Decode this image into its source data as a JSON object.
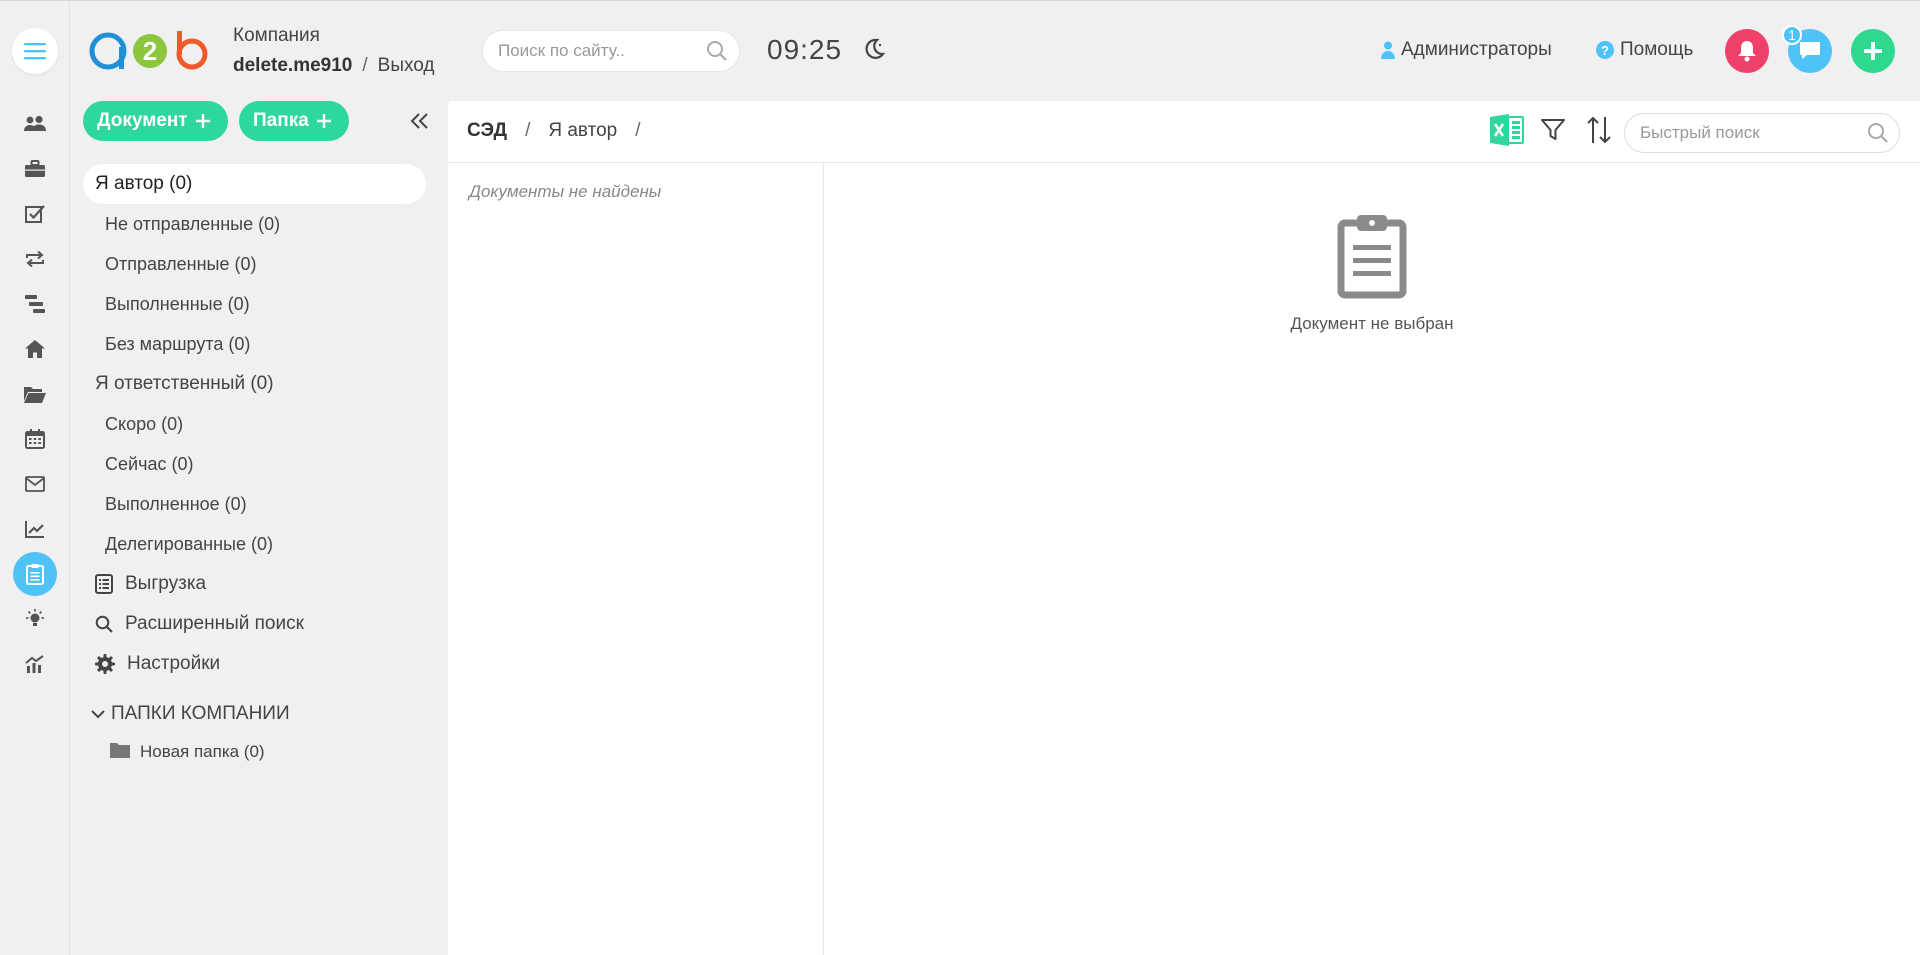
{
  "brand": {
    "logo_letters": "a2b"
  },
  "header": {
    "company_label": "Компания",
    "account": "delete.me910",
    "separator": "/",
    "logout": "Выход",
    "search_placeholder": "Поиск по сайту..",
    "clock": "09:25",
    "admins": "Администраторы",
    "help": "Помощь",
    "help_icon_glyph": "?",
    "chat_badge": "1",
    "accent_colors": {
      "bell": "#ef3f6b",
      "chat": "#4fc3f7",
      "plus": "#2ed88f"
    }
  },
  "rail": {
    "items": [
      "users-icon",
      "briefcase-icon",
      "checklist-icon",
      "exchange-icon",
      "timeline-icon",
      "home-icon",
      "folder-open-icon",
      "calendar-icon",
      "mail-icon",
      "chart-line-icon",
      "clipboard-icon",
      "lightbulb-icon",
      "analytics-icon"
    ],
    "active": "clipboard-icon"
  },
  "nav": {
    "new_document": "Документ",
    "new_folder": "Папка",
    "author": "Я автор (0)",
    "author_items": [
      "Не отправленные (0)",
      "Отправленные (0)",
      "Выполненные (0)",
      "Без маршрута (0)"
    ],
    "responsible": "Я ответственный (0)",
    "responsible_items": [
      "Скоро (0)",
      "Сейчас (0)",
      "Выполненное (0)",
      "Делегированные (0)"
    ],
    "export": "Выгрузка",
    "advanced_search": "Расширенный поиск",
    "settings": "Настройки",
    "company_folders": "ПАПКИ КОМПАНИИ",
    "folders": [
      "Новая папка (0)"
    ]
  },
  "main": {
    "breadcrumb_root": "СЭД",
    "breadcrumb_sep": "/",
    "breadcrumb_current": "Я автор",
    "quick_search_placeholder": "Быстрый поиск",
    "empty_list": "Документы не найдены",
    "empty_doc": "Документ не выбран"
  }
}
